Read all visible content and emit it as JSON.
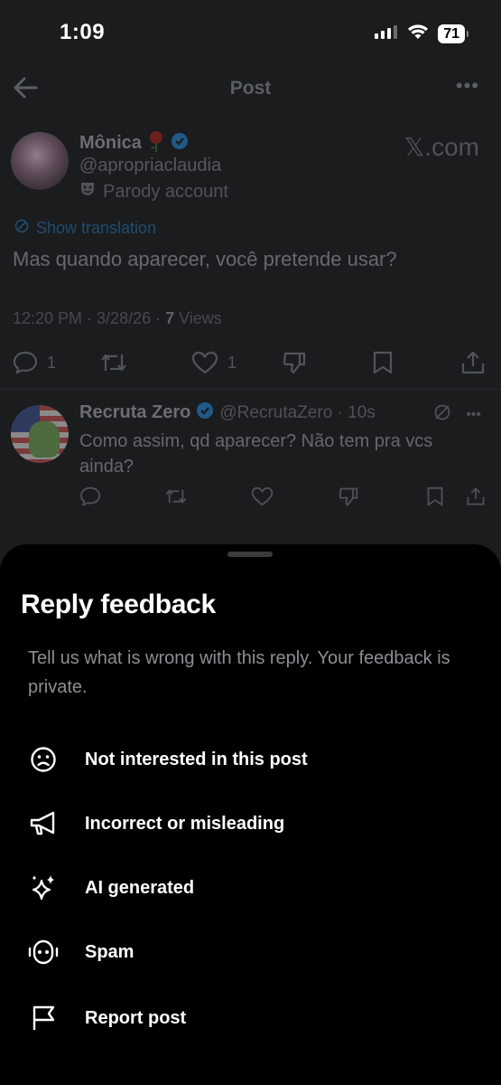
{
  "status_bar": {
    "time": "1:09",
    "battery": "71"
  },
  "header": {
    "title": "Post"
  },
  "post": {
    "author_name": "Mônica",
    "author_handle": "@apropriaclaudia",
    "parody_label": "Parody account",
    "watermark": "𝕏.com",
    "show_translation": "Show translation",
    "text": "Mas quando aparecer, você pretende usar?",
    "meta_time": "12:20 PM · 3/28/26 · ",
    "views_count": "7",
    "views_label": " Views",
    "reply_count": "1",
    "like_count": "1"
  },
  "reply": {
    "author_name": "Recruta Zero",
    "handle_time": "@RecrutaZero · 10s",
    "text": "Como assim, qd aparecer? Não tem pra vcs ainda?"
  },
  "sheet": {
    "title": "Reply feedback",
    "description": "Tell us what is wrong with this reply. Your feedback is private.",
    "options": [
      {
        "label": "Not interested in this post",
        "icon": "sad-face-icon"
      },
      {
        "label": "Incorrect or misleading",
        "icon": "megaphone-icon"
      },
      {
        "label": "AI generated",
        "icon": "sparkles-icon"
      },
      {
        "label": "Spam",
        "icon": "robot-icon"
      },
      {
        "label": "Report post",
        "icon": "flag-icon"
      }
    ]
  },
  "colors": {
    "sheet_bg": "#000000",
    "link": "#1d9bf0",
    "verified": "#1d9bf0"
  }
}
